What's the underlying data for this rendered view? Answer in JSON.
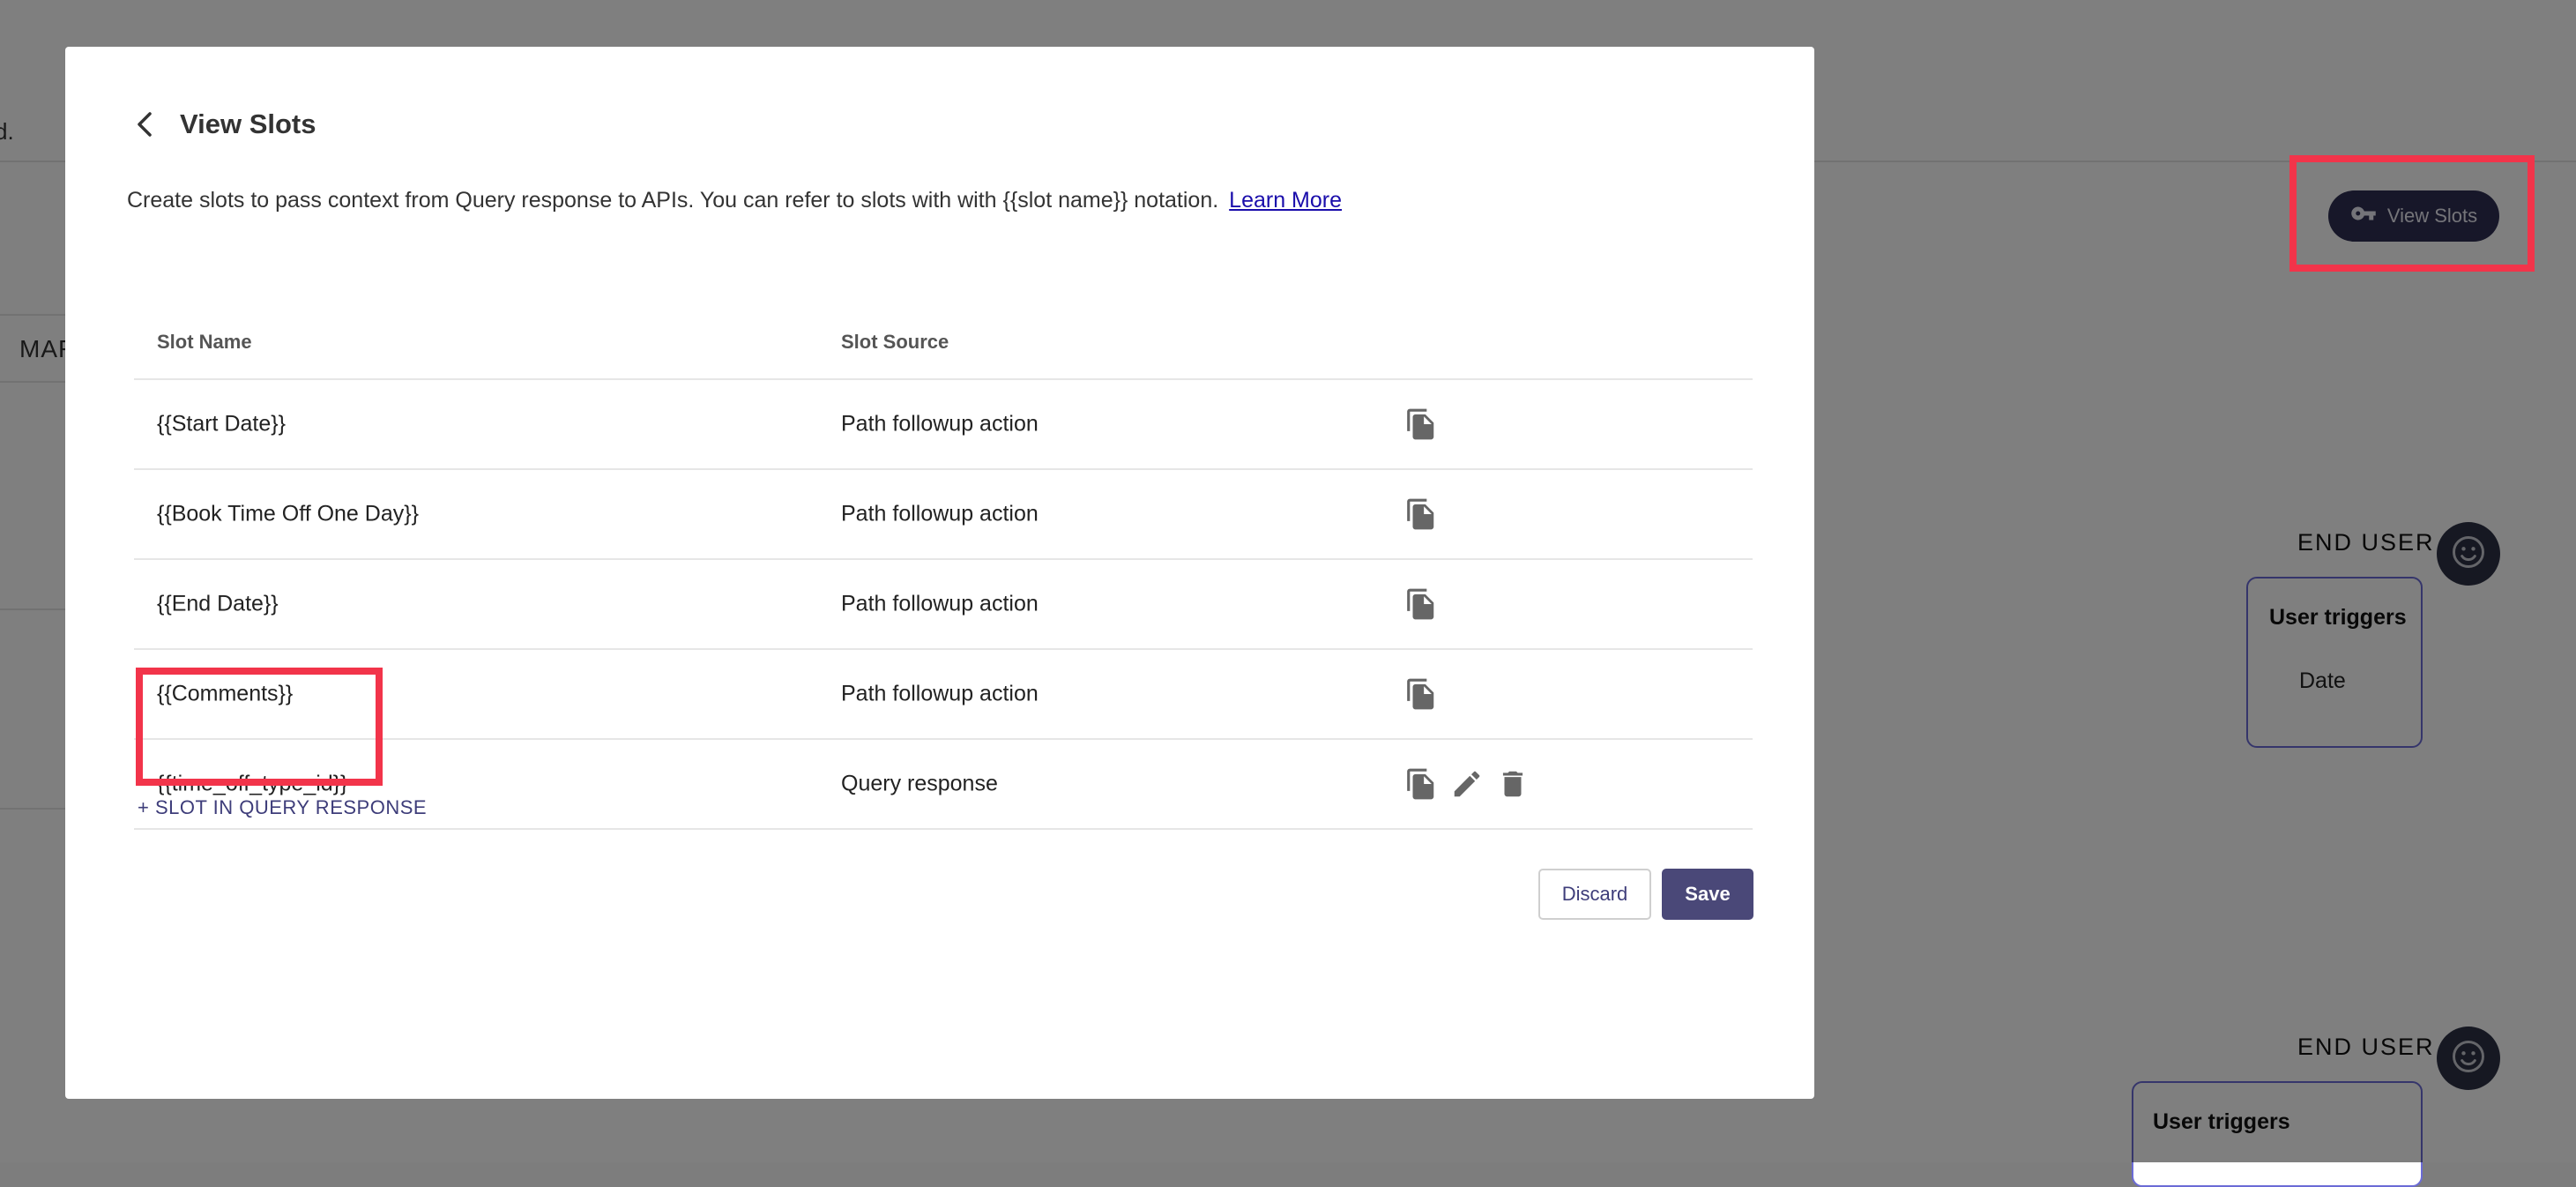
{
  "background": {
    "fragment_text": "d.",
    "mar_text": "MAF",
    "view_slots_button": {
      "label": "View Slots",
      "icon": "key-icon"
    },
    "end_user_blocks": [
      {
        "label": "END USER",
        "icon": "smiley-icon",
        "card_title": "User triggers",
        "card_value": "Date"
      },
      {
        "label": "END USER",
        "icon": "smiley-icon",
        "card_title": "User triggers",
        "card_value": ""
      }
    ]
  },
  "modal": {
    "title": "View Slots",
    "back_icon": "chevron-left-icon",
    "description": "Create slots to pass context from Query response to APIs. You can refer to slots with with {{slot name}} notation.",
    "learn_more_label": "Learn More",
    "table": {
      "headers": {
        "name": "Slot Name",
        "source": "Slot Source"
      },
      "rows": [
        {
          "name": "{{Start Date}}",
          "source": "Path followup action",
          "actions": [
            "copy"
          ]
        },
        {
          "name": "{{Book Time Off One Day}}",
          "source": "Path followup action",
          "actions": [
            "copy"
          ]
        },
        {
          "name": "{{End Date}}",
          "source": "Path followup action",
          "actions": [
            "copy"
          ]
        },
        {
          "name": "{{Comments}}",
          "source": "Path followup action",
          "actions": [
            "copy"
          ]
        },
        {
          "name": "{{time_off_type_id}}",
          "source": "Query response",
          "actions": [
            "copy",
            "edit",
            "delete"
          ]
        }
      ]
    },
    "add_slot_label": "+ SLOT IN QUERY RESPONSE",
    "discard_label": "Discard",
    "save_label": "Save"
  },
  "colors": {
    "primary": "#4a4878",
    "dark_button": "#2f2e52",
    "highlight": "#f2344a",
    "link": "#1a0dab"
  }
}
